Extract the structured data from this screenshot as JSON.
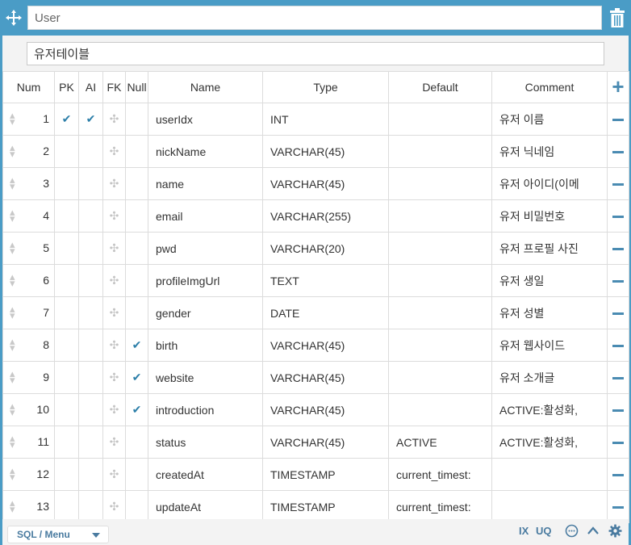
{
  "table": {
    "name": "User",
    "comment": "유저테이블"
  },
  "columns_header": {
    "num": "Num",
    "pk": "PK",
    "ai": "AI",
    "fk": "FK",
    "null": "Null",
    "name": "Name",
    "type": "Type",
    "default": "Default",
    "comment": "Comment"
  },
  "rows": [
    {
      "num": "1",
      "pk": true,
      "ai": true,
      "nn": false,
      "name": "userIdx",
      "type": "INT",
      "default": "",
      "comment": "유저 이름"
    },
    {
      "num": "2",
      "pk": false,
      "ai": false,
      "nn": false,
      "name": "nickName",
      "type": "VARCHAR(45)",
      "default": "",
      "comment": "유저 닉네임"
    },
    {
      "num": "3",
      "pk": false,
      "ai": false,
      "nn": false,
      "name": "name",
      "type": "VARCHAR(45)",
      "default": "",
      "comment": "유저 아이디(이메"
    },
    {
      "num": "4",
      "pk": false,
      "ai": false,
      "nn": false,
      "name": "email",
      "type": "VARCHAR(255)",
      "default": "",
      "comment": "유저 비밀번호"
    },
    {
      "num": "5",
      "pk": false,
      "ai": false,
      "nn": false,
      "name": "pwd",
      "type": "VARCHAR(20)",
      "default": "",
      "comment": "유저 프로필 사진"
    },
    {
      "num": "6",
      "pk": false,
      "ai": false,
      "nn": false,
      "name": "profileImgUrl",
      "type": "TEXT",
      "default": "",
      "comment": "유저 생일"
    },
    {
      "num": "7",
      "pk": false,
      "ai": false,
      "nn": false,
      "name": "gender",
      "type": "DATE",
      "default": "",
      "comment": "유저 성별"
    },
    {
      "num": "8",
      "pk": false,
      "ai": false,
      "nn": true,
      "name": "birth",
      "type": "VARCHAR(45)",
      "default": "",
      "comment": "유저 웹사이드"
    },
    {
      "num": "9",
      "pk": false,
      "ai": false,
      "nn": true,
      "name": "website",
      "type": "VARCHAR(45)",
      "default": "",
      "comment": "유저 소개글"
    },
    {
      "num": "10",
      "pk": false,
      "ai": false,
      "nn": true,
      "name": "introduction",
      "type": "VARCHAR(45)",
      "default": "",
      "comment": "ACTIVE:활성화,"
    },
    {
      "num": "11",
      "pk": false,
      "ai": false,
      "nn": false,
      "name": "status",
      "type": "VARCHAR(45)",
      "default": "ACTIVE",
      "comment": "ACTIVE:활성화,"
    },
    {
      "num": "12",
      "pk": false,
      "ai": false,
      "nn": false,
      "name": "createdAt",
      "type": "TIMESTAMP",
      "default": "current_timest:",
      "comment": ""
    },
    {
      "num": "13",
      "pk": false,
      "ai": false,
      "nn": false,
      "name": "updateAt",
      "type": "TIMESTAMP",
      "default": "current_timest:",
      "comment": ""
    }
  ],
  "footer": {
    "sql_menu": "SQL / Menu",
    "ix": "IX",
    "uq": "UQ"
  },
  "colors": {
    "accent": "#4a9cc6",
    "check": "#2b7ea8",
    "icon": "#4a8bb2"
  },
  "icons": {
    "move": "move-arrows-icon",
    "delete": "trash-icon",
    "add_column": "plus-icon",
    "remove_column": "minus-icon",
    "drag": "drag-handle-icon",
    "check": "checkmark-icon",
    "comment": "comment-bubble-icon",
    "collapse": "chevron-up-icon",
    "settings": "gear-icon"
  }
}
